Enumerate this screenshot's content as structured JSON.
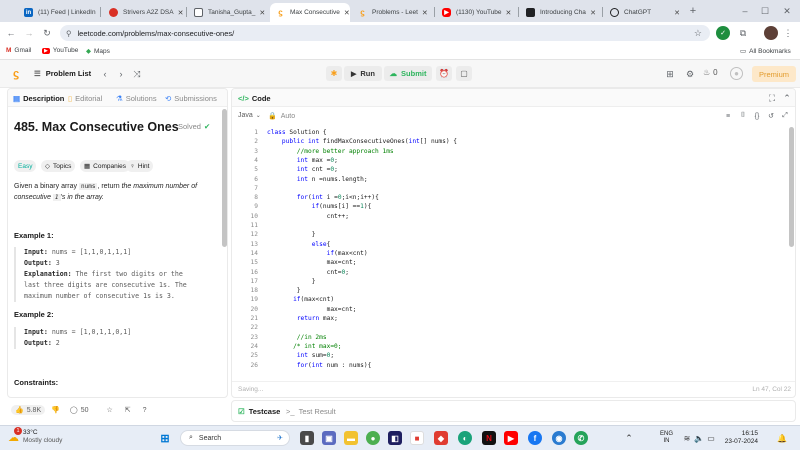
{
  "browser": {
    "tabs": [
      {
        "title": "(11) Feed | LinkedIn",
        "favicon": "LinkedIn",
        "color": "#0a66c2"
      },
      {
        "title": "Strivers A2Z DSA",
        "favicon": "tuf",
        "color": "#d93025"
      },
      {
        "title": "Tanisha_Gupta_",
        "favicon": "doc",
        "color": "#5f6368"
      },
      {
        "title": "Max Consecutive",
        "favicon": "leetcode",
        "color": "#f89f1b"
      },
      {
        "title": "Problems - Leet",
        "favicon": "leetcode",
        "color": "#f89f1b"
      },
      {
        "title": "(1130) YouTube",
        "favicon": "youtube",
        "color": "#ff0000"
      },
      {
        "title": "Introducing Cha",
        "favicon": "openai",
        "color": "#202124"
      },
      {
        "title": "ChatGPT",
        "favicon": "openai",
        "color": "#202124"
      }
    ],
    "url": "leetcode.com/problems/max-consecutive-ones/",
    "bookmarks": [
      "Gmail",
      "YouTube",
      "Maps"
    ],
    "all_bookmarks": "All Bookmarks"
  },
  "nav": {
    "problem_list": "Problem List",
    "run": "Run",
    "submit": "Submit",
    "streak": "0",
    "premium": "Premium"
  },
  "left": {
    "tabs": [
      "Description",
      "Editorial",
      "Solutions",
      "Submissions"
    ],
    "title": "485. Max Consecutive Ones",
    "solved": "Solved",
    "tags": [
      "Easy",
      "Topics",
      "Companies",
      "Hint"
    ],
    "desc_pre": "Given a binary array ",
    "desc_code": "nums",
    "desc_mid": ", return ",
    "desc_em": "the maximum number of consecutive ",
    "desc_one": "1",
    "desc_post": "'s in the array.",
    "ex1_title": "Example 1:",
    "ex1_input_label": "Input:",
    "ex1_input": "nums = [1,1,0,1,1,1]",
    "ex1_output_label": "Output:",
    "ex1_output": "3",
    "ex1_expl_label": "Explanation:",
    "ex1_expl_1": "The first two digits or the",
    "ex1_expl_2": "last three digits are consecutive 1s. The",
    "ex1_expl_3": "maximum number of consecutive 1s is 3.",
    "ex2_title": "Example 2:",
    "ex2_input_label": "Input:",
    "ex2_input": "nums = [1,0,1,1,0,1]",
    "ex2_output_label": "Output:",
    "ex2_output": "2",
    "constraints": "Constraints:",
    "likes": "5.8K",
    "comments": "50"
  },
  "code": {
    "header": "Code",
    "language": "Java",
    "mode": "Auto",
    "status": "Saving...",
    "position": "Ln 47, Col 22",
    "lines": [
      "class Solution {",
      "    public int findMaxConsecutiveOnes(int[] nums) {",
      "        //more better approach 1ms",
      "        int max =0;",
      "        int cnt =0;",
      "        int n =nums.length;",
      "",
      "        for(int i =0;i<n;i++){",
      "            if(nums[i] ==1){",
      "                cnt++;",
      "",
      "            }",
      "            else{",
      "                if(max<cnt)",
      "                max=cnt;",
      "                cnt=0;",
      "            }",
      "        }",
      "       if(max<cnt)",
      "                max=cnt;",
      "        return max;",
      "",
      "        //in 2ms",
      "       /* int max=0;",
      "        int sum=0;",
      "        for(int num : nums){"
    ]
  },
  "testcase": {
    "tab1": "Testcase",
    "tab2": "Test Result"
  },
  "taskbar": {
    "temp": "33°C",
    "weather": "Mostly cloudy",
    "search": "Search",
    "lang1": "ENG",
    "lang2": "IN",
    "time": "16:15",
    "date": "23-07-2024",
    "badge": "1"
  }
}
